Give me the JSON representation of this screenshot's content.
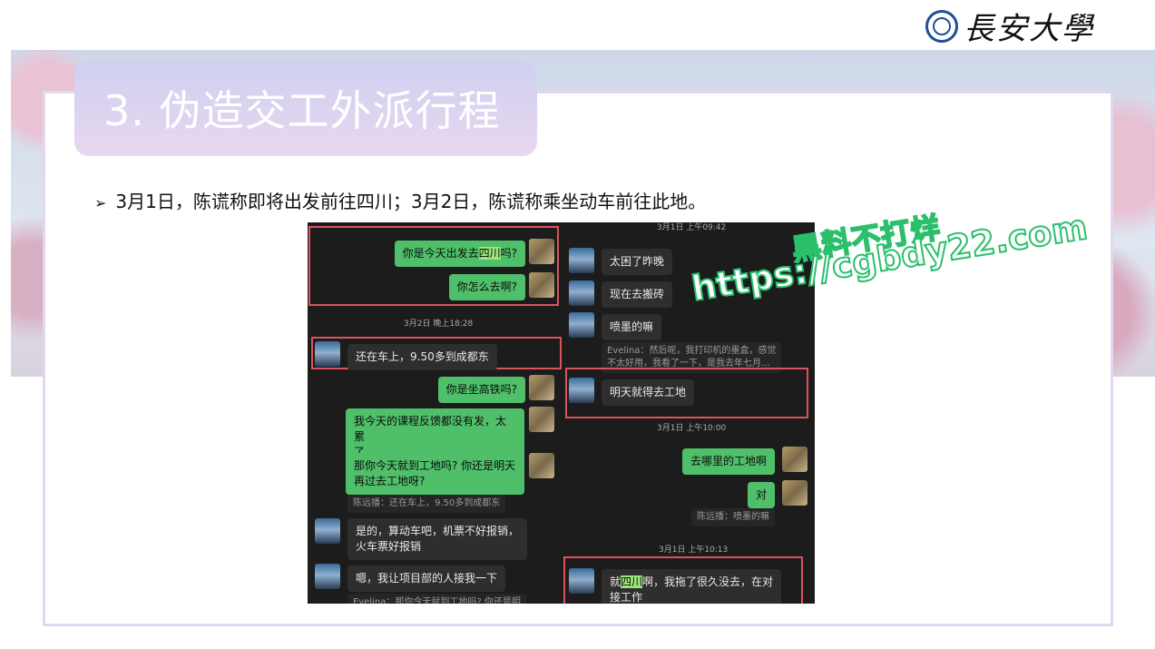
{
  "logo": {
    "text": "長安大學",
    "seal_icon": "university-seal-icon"
  },
  "slide": {
    "title": "3. 伪造交工外派行程",
    "bullet": "3月1日，陈谎称即将出发前往四川；3月2日，陈谎称乘坐动车前往此地。"
  },
  "watermark": {
    "line1": "黑料不打烊",
    "line2": "https://cgbdy22.com"
  },
  "chat_left": {
    "m1_pre": "你是今天出发去",
    "m1_hl": "四川",
    "m1_post": "吗?",
    "m2": "你怎么去啊?",
    "ts1": "3月2日 晚上18:28",
    "m3": "还在车上，9.50多到成都东",
    "m4": "你是坐高铁吗?",
    "m5a": "我今天的课程反馈都没有发，太累",
    "m5b": "了",
    "m6a": "那你今天就到工地吗? 你还是明天",
    "m6b": "再过去工地呀?",
    "q1": "陈远播：还在车上，9.50多到成都东",
    "m7a": "是的，算动车吧，机票不好报销，",
    "m7b": "火车票好报销",
    "m8": "嗯，我让项目部的人接我一下",
    "q2": "Evelina：那你今天就到工地吗? 你还是明"
  },
  "chat_right": {
    "ts0": "3月1日 上午09:42",
    "m1": "太困了昨晚",
    "m2": "现在去搬砖",
    "m3": "喷墨的嘛",
    "q1a": "Evelina：然后呢，我打印机的墨盒，感觉",
    "q1b": "不太好用，我看了一下，是我去年七月…",
    "m4": "明天就得去工地",
    "ts1": "3月1日 上午10:00",
    "m5": "去哪里的工地啊",
    "m6": "对",
    "q2": "陈远播：喷墨的嘛",
    "ts2": "3月1日 上午10:13",
    "m7_pre": "就",
    "m7_hl": "四川",
    "m7_post": "啊，我拖了很久没去，在对",
    "m7b": "接工作"
  },
  "colors": {
    "accent_red": "#d9545c",
    "bubble_green": "#4fbf6a",
    "title_bg": "#d8d2f0",
    "watermark_green": "#2bbf6c"
  }
}
